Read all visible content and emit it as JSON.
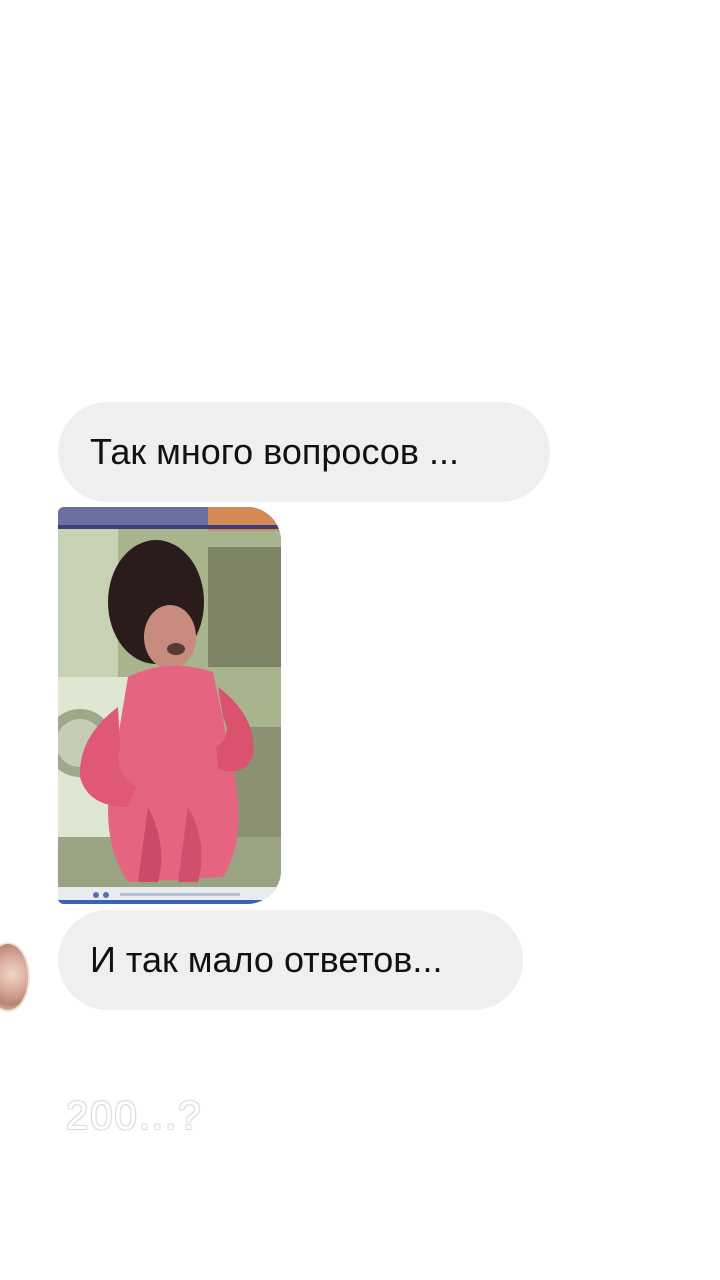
{
  "messages": [
    {
      "text": "Так много вопросов ..."
    },
    {
      "text": "И так мало ответов..."
    }
  ],
  "media": {
    "icon": "photo-of-child-in-pink-dress"
  },
  "avatar": {
    "icon": "user-avatar"
  },
  "caption": {
    "text": "200...?"
  },
  "colors": {
    "bubble": "#efefef",
    "text": "#111111",
    "background": "#ffffff",
    "caption": "#ffffff"
  }
}
